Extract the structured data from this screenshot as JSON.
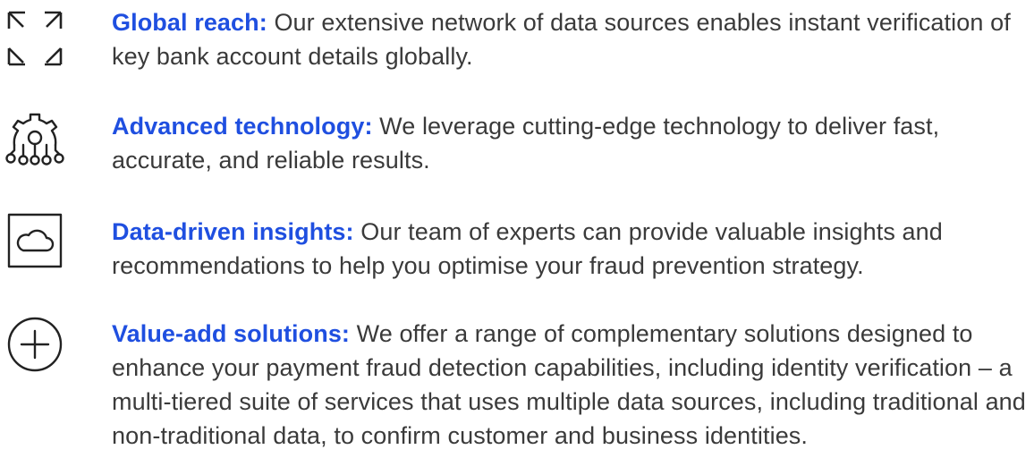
{
  "items": [
    {
      "icon": "expand-arrows-icon",
      "title": "Global reach:",
      "body": " Our extensive network of data sources enables instant verification of key bank account details globally."
    },
    {
      "icon": "gear-circuit-icon",
      "title": "Advanced technology:",
      "body": " We leverage cutting-edge technology to deliver fast, accurate, and reliable results."
    },
    {
      "icon": "cloud-icon",
      "title": "Data-driven insights:",
      "body": " Our team of experts can provide valuable insights and recommendations to help you optimise your fraud prevention strategy."
    },
    {
      "icon": "plus-circle-icon",
      "title": "Value-add solutions:",
      "body": " We offer a range of complementary solutions designed to enhance your payment fraud detection capabilities, including identity verification – a multi-tiered suite of services that uses multiple data sources, including traditional and non-traditional data, to confirm customer and business identities."
    }
  ],
  "colors": {
    "title": "#1f4fe0",
    "body": "#3a3a3a",
    "icon": "#222222"
  }
}
